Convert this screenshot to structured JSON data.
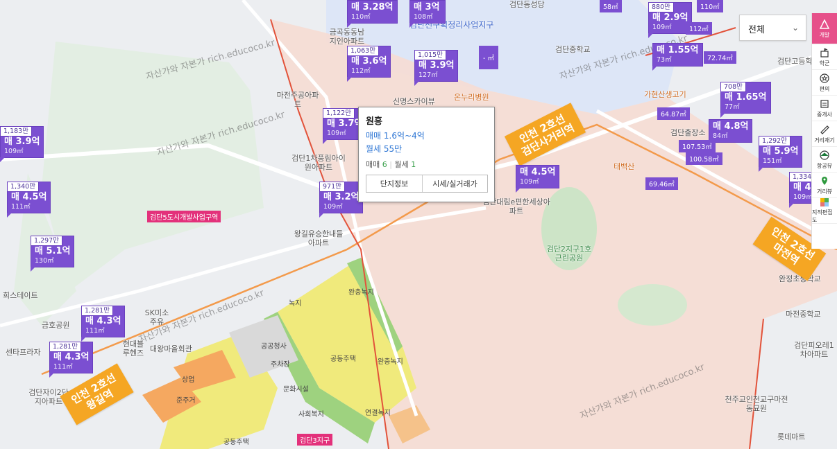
{
  "watermark_text": "자산가와 자본가 rich.educoco.kr",
  "colors": {
    "marker": "#7b4fd1",
    "station": "#f5a623",
    "accent": "#e6508a",
    "price_text": "#2e76d4"
  },
  "dropdown": {
    "value": "전체"
  },
  "sidebar": [
    {
      "label": "개발",
      "icon": "triangle-icon"
    },
    {
      "label": "학군",
      "icon": "school-icon"
    },
    {
      "label": "편의",
      "icon": "star-icon"
    },
    {
      "label": "중개사",
      "icon": "agent-icon"
    },
    {
      "label": "거리재기",
      "icon": "ruler-icon"
    },
    {
      "label": "항공뷰",
      "icon": "drone-icon"
    },
    {
      "label": "거리뷰",
      "icon": "pin-icon"
    },
    {
      "label": "지적편집도",
      "icon": "grid-icon"
    }
  ],
  "popup": {
    "title": "원흥",
    "sale": "매매 1.6억~4억",
    "rent": "월세 55만",
    "sale_label": "매매",
    "sale_count": "6",
    "rent_label": "월세",
    "rent_count": "1",
    "btn_info": "단지정보",
    "btn_price": "시세/실거래가"
  },
  "stations": [
    {
      "line1": "인천 2호선",
      "line2": "검단사거리역"
    },
    {
      "line1": "인천 2호선",
      "line2": "왕길역"
    },
    {
      "line1": "인천 2호선",
      "line2": "마전역"
    }
  ],
  "zone_tags": [
    "검단5도시개발사업구역",
    "검단3지구"
  ],
  "markers": [
    {
      "top": "",
      "main": "매 3.28억",
      "area": "110㎡"
    },
    {
      "top": "",
      "main": "매 3억",
      "area": "108㎡"
    },
    {
      "top": "1,063만",
      "main": "매 3.6억",
      "area": "112㎡"
    },
    {
      "top": "1,015만",
      "main": "매 3.9억",
      "area": "127㎡"
    },
    {
      "top": "1,122만",
      "main": "매 3.7억",
      "area": "109㎡"
    },
    {
      "top": "971만",
      "main": "매 3.2억",
      "area": "109㎡"
    },
    {
      "top": "",
      "main": "매 4.5억",
      "area": "109㎡"
    },
    {
      "top": "1,183만",
      "main": "매 3.9억",
      "area": "109㎡"
    },
    {
      "top": "1,340만",
      "main": "매 4.5억",
      "area": "111㎡"
    },
    {
      "top": "1,297만",
      "main": "매 5.1억",
      "area": "130㎡"
    },
    {
      "top": "1,281만",
      "main": "매 4.3억",
      "area": "111㎡"
    },
    {
      "top": "1,281만",
      "main": "매 4.3억",
      "area": "111㎡"
    },
    {
      "top": "880만",
      "main": "매 2.9억",
      "area": "109㎡"
    },
    {
      "top": "",
      "main": "매 1.55억",
      "area": "73㎡"
    },
    {
      "top": "708만",
      "main": "매 1.65억",
      "area": "77㎡"
    },
    {
      "top": "",
      "main": "매 4.8억",
      "area": "84㎡"
    },
    {
      "top": "1,292만",
      "main": "매 5.9억",
      "area": "151㎡"
    },
    {
      "top": "1,334",
      "main": "매 4.",
      "area": "109㎡"
    }
  ],
  "small_markers": [
    "58㎡",
    "110㎡",
    "- ㎡",
    "72.74㎡",
    "64.87㎡",
    "107.53㎡",
    "100.58㎡",
    "69.46㎡",
    "112㎡"
  ],
  "pois": [
    "금곡동동남지인아파트",
    "검단동성당",
    "마전주공아파트",
    "온누리병원",
    "신명스카이뷰",
    "검단중학교",
    "가현산생고기",
    "검단1차풍림아이원아파트",
    "왕길유승한내들아파트",
    "검단대림e편한세상아파트",
    "검단2지구1호근린공원",
    "태백산",
    "검단출장소",
    "완정초등학교",
    "마전중학교",
    "검단피오레1차아파트",
    "천주교인천교구마전동묘원",
    "롯데마트",
    "금호공원",
    "센타프라자",
    "검단자이2단지아파트",
    "현대블루헨즈",
    "대왕마을회관",
    "SK미소주유",
    "녹지",
    "완충녹지",
    "공동주택",
    "공공청사",
    "주차장",
    "문화시설",
    "사회복지",
    "연결녹지",
    "준주거",
    "상업",
    "검단고등학",
    "검단선구획정리사업지구",
    "희스테이트"
  ]
}
